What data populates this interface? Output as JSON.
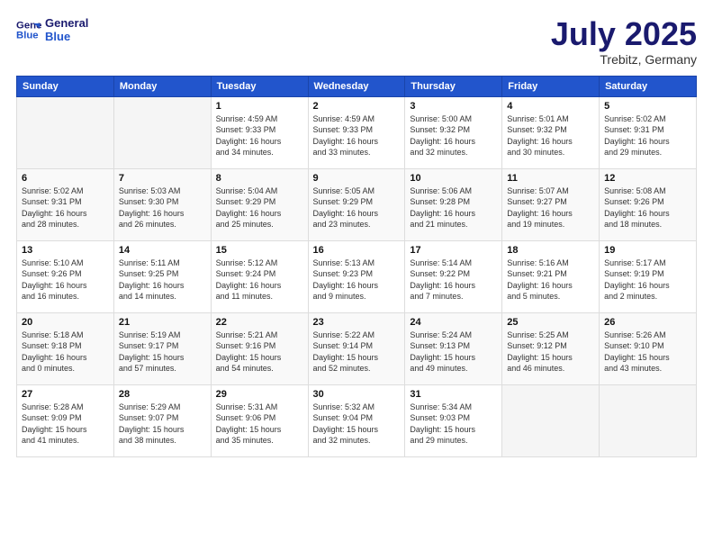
{
  "logo": {
    "line1": "General",
    "line2": "Blue"
  },
  "title": "July 2025",
  "subtitle": "Trebitz, Germany",
  "weekdays": [
    "Sunday",
    "Monday",
    "Tuesday",
    "Wednesday",
    "Thursday",
    "Friday",
    "Saturday"
  ],
  "weeks": [
    [
      {
        "day": "",
        "info": ""
      },
      {
        "day": "",
        "info": ""
      },
      {
        "day": "1",
        "info": "Sunrise: 4:59 AM\nSunset: 9:33 PM\nDaylight: 16 hours\nand 34 minutes."
      },
      {
        "day": "2",
        "info": "Sunrise: 4:59 AM\nSunset: 9:33 PM\nDaylight: 16 hours\nand 33 minutes."
      },
      {
        "day": "3",
        "info": "Sunrise: 5:00 AM\nSunset: 9:32 PM\nDaylight: 16 hours\nand 32 minutes."
      },
      {
        "day": "4",
        "info": "Sunrise: 5:01 AM\nSunset: 9:32 PM\nDaylight: 16 hours\nand 30 minutes."
      },
      {
        "day": "5",
        "info": "Sunrise: 5:02 AM\nSunset: 9:31 PM\nDaylight: 16 hours\nand 29 minutes."
      }
    ],
    [
      {
        "day": "6",
        "info": "Sunrise: 5:02 AM\nSunset: 9:31 PM\nDaylight: 16 hours\nand 28 minutes."
      },
      {
        "day": "7",
        "info": "Sunrise: 5:03 AM\nSunset: 9:30 PM\nDaylight: 16 hours\nand 26 minutes."
      },
      {
        "day": "8",
        "info": "Sunrise: 5:04 AM\nSunset: 9:29 PM\nDaylight: 16 hours\nand 25 minutes."
      },
      {
        "day": "9",
        "info": "Sunrise: 5:05 AM\nSunset: 9:29 PM\nDaylight: 16 hours\nand 23 minutes."
      },
      {
        "day": "10",
        "info": "Sunrise: 5:06 AM\nSunset: 9:28 PM\nDaylight: 16 hours\nand 21 minutes."
      },
      {
        "day": "11",
        "info": "Sunrise: 5:07 AM\nSunset: 9:27 PM\nDaylight: 16 hours\nand 19 minutes."
      },
      {
        "day": "12",
        "info": "Sunrise: 5:08 AM\nSunset: 9:26 PM\nDaylight: 16 hours\nand 18 minutes."
      }
    ],
    [
      {
        "day": "13",
        "info": "Sunrise: 5:10 AM\nSunset: 9:26 PM\nDaylight: 16 hours\nand 16 minutes."
      },
      {
        "day": "14",
        "info": "Sunrise: 5:11 AM\nSunset: 9:25 PM\nDaylight: 16 hours\nand 14 minutes."
      },
      {
        "day": "15",
        "info": "Sunrise: 5:12 AM\nSunset: 9:24 PM\nDaylight: 16 hours\nand 11 minutes."
      },
      {
        "day": "16",
        "info": "Sunrise: 5:13 AM\nSunset: 9:23 PM\nDaylight: 16 hours\nand 9 minutes."
      },
      {
        "day": "17",
        "info": "Sunrise: 5:14 AM\nSunset: 9:22 PM\nDaylight: 16 hours\nand 7 minutes."
      },
      {
        "day": "18",
        "info": "Sunrise: 5:16 AM\nSunset: 9:21 PM\nDaylight: 16 hours\nand 5 minutes."
      },
      {
        "day": "19",
        "info": "Sunrise: 5:17 AM\nSunset: 9:19 PM\nDaylight: 16 hours\nand 2 minutes."
      }
    ],
    [
      {
        "day": "20",
        "info": "Sunrise: 5:18 AM\nSunset: 9:18 PM\nDaylight: 16 hours\nand 0 minutes."
      },
      {
        "day": "21",
        "info": "Sunrise: 5:19 AM\nSunset: 9:17 PM\nDaylight: 15 hours\nand 57 minutes."
      },
      {
        "day": "22",
        "info": "Sunrise: 5:21 AM\nSunset: 9:16 PM\nDaylight: 15 hours\nand 54 minutes."
      },
      {
        "day": "23",
        "info": "Sunrise: 5:22 AM\nSunset: 9:14 PM\nDaylight: 15 hours\nand 52 minutes."
      },
      {
        "day": "24",
        "info": "Sunrise: 5:24 AM\nSunset: 9:13 PM\nDaylight: 15 hours\nand 49 minutes."
      },
      {
        "day": "25",
        "info": "Sunrise: 5:25 AM\nSunset: 9:12 PM\nDaylight: 15 hours\nand 46 minutes."
      },
      {
        "day": "26",
        "info": "Sunrise: 5:26 AM\nSunset: 9:10 PM\nDaylight: 15 hours\nand 43 minutes."
      }
    ],
    [
      {
        "day": "27",
        "info": "Sunrise: 5:28 AM\nSunset: 9:09 PM\nDaylight: 15 hours\nand 41 minutes."
      },
      {
        "day": "28",
        "info": "Sunrise: 5:29 AM\nSunset: 9:07 PM\nDaylight: 15 hours\nand 38 minutes."
      },
      {
        "day": "29",
        "info": "Sunrise: 5:31 AM\nSunset: 9:06 PM\nDaylight: 15 hours\nand 35 minutes."
      },
      {
        "day": "30",
        "info": "Sunrise: 5:32 AM\nSunset: 9:04 PM\nDaylight: 15 hours\nand 32 minutes."
      },
      {
        "day": "31",
        "info": "Sunrise: 5:34 AM\nSunset: 9:03 PM\nDaylight: 15 hours\nand 29 minutes."
      },
      {
        "day": "",
        "info": ""
      },
      {
        "day": "",
        "info": ""
      }
    ]
  ]
}
